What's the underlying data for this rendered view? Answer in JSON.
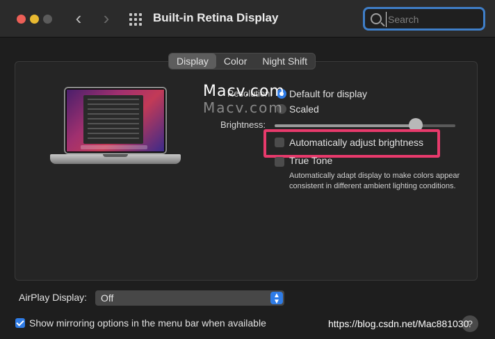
{
  "window": {
    "title": "Built-in Retina Display"
  },
  "toolbar": {
    "back_glyph": "‹",
    "forward_glyph": "›",
    "grid_icon": "grid-icon",
    "search": {
      "placeholder": "Search",
      "value": ""
    }
  },
  "tabs": [
    {
      "label": "Display",
      "active": true
    },
    {
      "label": "Color",
      "active": false
    },
    {
      "label": "Night Shift",
      "active": false
    }
  ],
  "display": {
    "resolution_label": "Resolution:",
    "resolution_options": [
      {
        "label": "Default for display",
        "selected": true
      },
      {
        "label": "Scaled",
        "selected": false
      }
    ],
    "brightness_label": "Brightness:",
    "brightness_value": 0.78,
    "auto_brightness": {
      "label": "Automatically adjust brightness",
      "checked": false
    },
    "true_tone": {
      "label": "True Tone",
      "checked": false,
      "description": "Automatically adapt display to make colors appear consistent in different ambient lighting conditions."
    }
  },
  "airplay": {
    "label": "AirPlay Display:",
    "value": "Off"
  },
  "mirroring": {
    "label": "Show mirroring options in the menu bar when available",
    "checked": true
  },
  "help": {
    "label": "?"
  },
  "watermark": {
    "line1": "Macv.com",
    "line2": "Macv.com"
  },
  "footer_url": "https://blog.csdn.net/Mac881030",
  "colors": {
    "accent": "#2f7ce6",
    "highlight": "#e83a6c",
    "search_ring": "#3f7fc9"
  }
}
